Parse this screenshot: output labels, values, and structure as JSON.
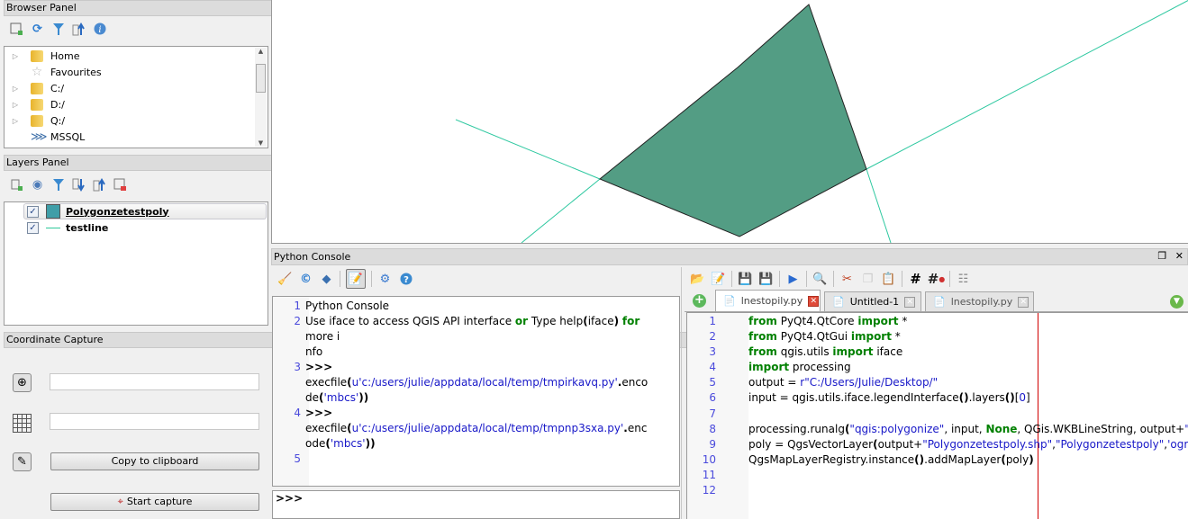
{
  "browser_panel": {
    "title": "Browser Panel",
    "float_icon": "❐",
    "close_icon": "✕",
    "toolbar": [
      "add-layer-icon",
      "refresh-icon",
      "filter-icon",
      "collapse-all-icon",
      "properties-icon"
    ],
    "items": [
      {
        "label": "Home",
        "icon": "folder",
        "expandable": true
      },
      {
        "label": "Favourites",
        "icon": "star",
        "expandable": false
      },
      {
        "label": "C:/",
        "icon": "folder",
        "expandable": true
      },
      {
        "label": "D:/",
        "icon": "folder",
        "expandable": true
      },
      {
        "label": "Q:/",
        "icon": "folder",
        "expandable": true
      },
      {
        "label": "MSSQL",
        "icon": "mssql",
        "expandable": false
      }
    ]
  },
  "layers_panel": {
    "title": "Layers Panel",
    "toolbar": [
      "add-group-icon",
      "visibility-icon",
      "filter-icon",
      "expand-all-icon",
      "collapse-all-icon",
      "remove-layer-icon"
    ],
    "layers": [
      {
        "name": "Polygonzetestpoly",
        "checked": true,
        "symbol": "polygon",
        "color": "#3f9ea8",
        "selected": true
      },
      {
        "name": "testline",
        "checked": true,
        "symbol": "line",
        "color": "#2ec89a",
        "selected": false
      }
    ]
  },
  "coordinate_capture": {
    "title": "Coordinate Capture",
    "field1_value": "",
    "field2_value": "",
    "copy_button": "Copy to clipboard",
    "start_button": "Start capture"
  },
  "map": {
    "polygon_fill": "#539d84",
    "line_color": "#2ec8a0"
  },
  "python_console": {
    "title": "Python Console",
    "output_lines": [
      {
        "num": "1",
        "html": "Python Console"
      },
      {
        "num": "2",
        "html": "Use iface to access QGIS API interface <span class='kw'>or</span> Type help<span class='op'>(</span>iface<span class='op'>)</span> <span class='kw'>for</span> more i<br>nfo"
      },
      {
        "num": "3",
        "html": "<span class='op'>&gt;&gt;&gt;</span> execfile<span class='op'>(</span><span class='str'>u'c:/users/julie/appdata/local/temp/tmpirkavq.py'</span><span class='op'>.</span>enco<br>de<span class='op'>(</span><span class='str'>'mbcs'</span><span class='op'>))</span>"
      },
      {
        "num": "4",
        "html": "<span class='op'>&gt;&gt;&gt;</span> execfile<span class='op'>(</span><span class='str'>u'c:/users/julie/appdata/local/temp/tmpnp3sxa.py'</span><span class='op'>.</span>enc<br>ode<span class='op'>(</span><span class='str'>'mbcs'</span><span class='op'>))</span>"
      },
      {
        "num": "5",
        "html": ""
      }
    ],
    "prompt": ">>>",
    "input_value": ""
  },
  "editor": {
    "tabs": [
      {
        "label": "lnestopily.py",
        "active": true
      },
      {
        "label": "Untitled-1",
        "active": false
      },
      {
        "label": "lnestopily.py",
        "active": false
      }
    ],
    "lines": [
      {
        "num": "1",
        "html": "<span class='kw'>from</span> PyQt4.QtCore <span class='kw'>import</span> *"
      },
      {
        "num": "2",
        "html": "<span class='kw'>from</span> PyQt4.QtGui <span class='kw'>import</span> *"
      },
      {
        "num": "3",
        "html": "<span class='kw'>from</span> qgis.utils <span class='kw'>import</span> iface"
      },
      {
        "num": "4",
        "html": "<span class='kw'>import</span> processing"
      },
      {
        "num": "5",
        "html": "output = <span class='str'>r\"C:/Users/Julie/Desktop/\"</span>"
      },
      {
        "num": "6",
        "html": "input = qgis.utils.iface.legendInterface<span class='op'>()</span>.layers<span class='op'>()</span>[<span class='str'>0</span>]"
      },
      {
        "num": "7",
        "html": ""
      },
      {
        "num": "8",
        "html": "processing.runalg<span class='op'>(</span><span class='str'>\"qgis:polygonize\"</span>, input, <span class='kw'>None</span>, QGis.WKBLineString, output+<span class='str'>\"Polygonzetestpoly.shp\"</span>"
      },
      {
        "num": "9",
        "html": "poly = QgsVectorLayer<span class='op'>(</span>output+<span class='str'>\"Polygonzetestpoly.shp\"</span>,<span class='str'>\"Polygonzetestpoly\"</span>,<span class='str'>'ogr'</span><span class='op'>)</span>"
      },
      {
        "num": "10",
        "html": "QgsMapLayerRegistry.instance<span class='op'>()</span>.addMapLayer<span class='op'>(</span>poly<span class='op'>)</span>"
      },
      {
        "num": "11",
        "html": ""
      },
      {
        "num": "12",
        "html": ""
      }
    ]
  }
}
